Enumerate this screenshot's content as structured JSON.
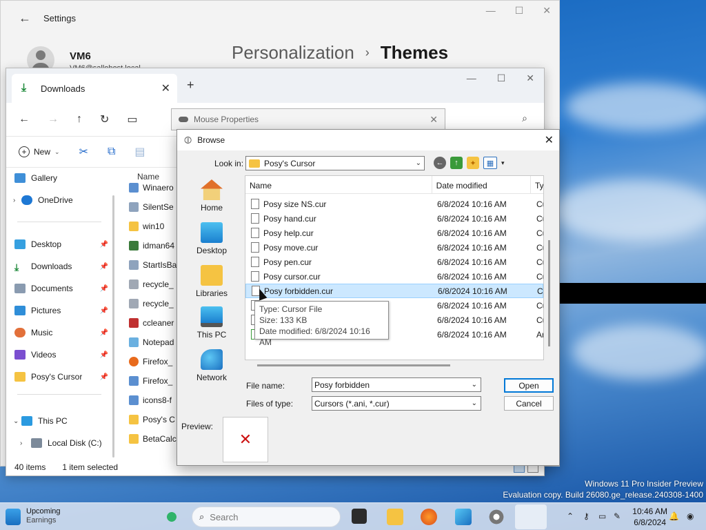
{
  "settings": {
    "title": "Settings",
    "user_name": "VM6",
    "user_email": "VM6@sallohost.local",
    "breadcrumb_parent": "Personalization",
    "breadcrumb_current": "Themes"
  },
  "explorer": {
    "tab_label": "Downloads",
    "new_label": "New",
    "column_name": "Name",
    "sidebar": [
      {
        "label": "Gallery"
      },
      {
        "label": "OneDrive"
      },
      {
        "label": "Desktop"
      },
      {
        "label": "Downloads"
      },
      {
        "label": "Documents"
      },
      {
        "label": "Pictures"
      },
      {
        "label": "Music"
      },
      {
        "label": "Videos"
      },
      {
        "label": "Posy's Cursor"
      },
      {
        "label": "This PC"
      },
      {
        "label": "Local Disk (C:)"
      }
    ],
    "files": [
      "Winaero",
      "SilentSe",
      "win10",
      "idman64",
      "StartIsBa",
      "recycle_",
      "recycle_",
      "ccleaner",
      "Notepad",
      "Firefox_",
      "Firefox_",
      "icons8-f",
      "Posy's C",
      "BetaCalcu"
    ],
    "status_count": "40 items",
    "status_selected": "1 item selected"
  },
  "mouse_properties": {
    "title": "Mouse Properties"
  },
  "browse": {
    "title": "Browse",
    "look_in_label": "Look in:",
    "look_in_value": "Posy's Cursor",
    "places": [
      "Home",
      "Desktop",
      "Libraries",
      "This PC",
      "Network"
    ],
    "columns": {
      "name": "Name",
      "date": "Date modified",
      "type": "Ty"
    },
    "rows": [
      {
        "name": "Posy size NS.cur",
        "date": "6/8/2024 10:16 AM",
        "type": "Cu"
      },
      {
        "name": "Posy hand.cur",
        "date": "6/8/2024 10:16 AM",
        "type": "Cu"
      },
      {
        "name": "Posy help.cur",
        "date": "6/8/2024 10:16 AM",
        "type": "Cu"
      },
      {
        "name": "Posy move.cur",
        "date": "6/8/2024 10:16 AM",
        "type": "Cu"
      },
      {
        "name": "Posy pen.cur",
        "date": "6/8/2024 10:16 AM",
        "type": "Cu"
      },
      {
        "name": "Posy cursor.cur",
        "date": "6/8/2024 10:16 AM",
        "type": "Cu"
      },
      {
        "name": "Posy forbidden.cur",
        "date": "6/8/2024 10:16 AM",
        "type": "Cu"
      },
      {
        "name": "",
        "date": "6/8/2024 10:16 AM",
        "type": "Cu"
      },
      {
        "name": "",
        "date": "6/8/2024 10:16 AM",
        "type": "Cu"
      },
      {
        "name": "",
        "date": "6/8/2024 10:16 AM",
        "type": "Ar"
      }
    ],
    "tooltip": {
      "type": "Type: Cursor File",
      "size": "Size: 133 KB",
      "date": "Date modified: 6/8/2024 10:16 AM"
    },
    "file_name_label": "File name:",
    "file_name_value": "Posy forbidden",
    "files_of_type_label": "Files of type:",
    "files_of_type_value": "Cursors (*.ani, *.cur)",
    "open_label": "Open",
    "cancel_label": "Cancel",
    "preview_label": "Preview:"
  },
  "desktop": {
    "watermark_line1": "Windows 11 Pro Insider Preview",
    "watermark_line2": "Evaluation copy. Build 26080.ge_release.240308-1400"
  },
  "taskbar": {
    "widget_line1": "Upcoming",
    "widget_line2": "Earnings",
    "search_placeholder": "Search",
    "time": "10:46 AM",
    "date": "6/8/2024"
  }
}
